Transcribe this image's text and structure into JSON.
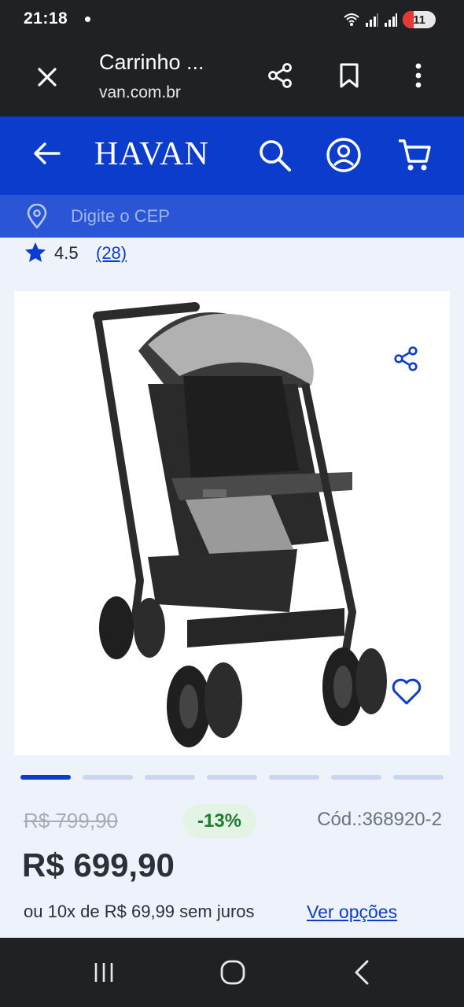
{
  "status_bar": {
    "time": "21:18",
    "battery": "11",
    "icons": [
      "notification-dot-icon",
      "wifi-icon",
      "signal-icon",
      "signal-icon",
      "battery-icon"
    ]
  },
  "browser": {
    "title": "Carrinho ...",
    "url": "van.com.br",
    "icons": [
      "close-icon",
      "share-icon",
      "bookmark-icon",
      "more-vert-icon"
    ]
  },
  "header": {
    "logo": "HAVAN",
    "cep_placeholder": "Digite o CEP",
    "brand_color": "#0c3ccb",
    "icons": [
      "back-arrow-icon",
      "search-icon",
      "account-icon",
      "cart-icon",
      "location-pin-icon"
    ]
  },
  "rating": {
    "value": "4.5",
    "count": "(28)"
  },
  "gallery": {
    "slides": 7,
    "active_slide": 1,
    "icons": [
      "share-icon",
      "heart-icon"
    ]
  },
  "pricing": {
    "old_price": "R$ 799,90",
    "discount": "-13%",
    "code": "Cód.:368920-2",
    "price": "R$ 699,90",
    "installments": "ou 10x de R$ 69,99 sem juros",
    "options_link": "Ver opções"
  },
  "nav": {
    "icons": [
      "recent-apps-icon",
      "home-icon",
      "back-icon"
    ]
  }
}
